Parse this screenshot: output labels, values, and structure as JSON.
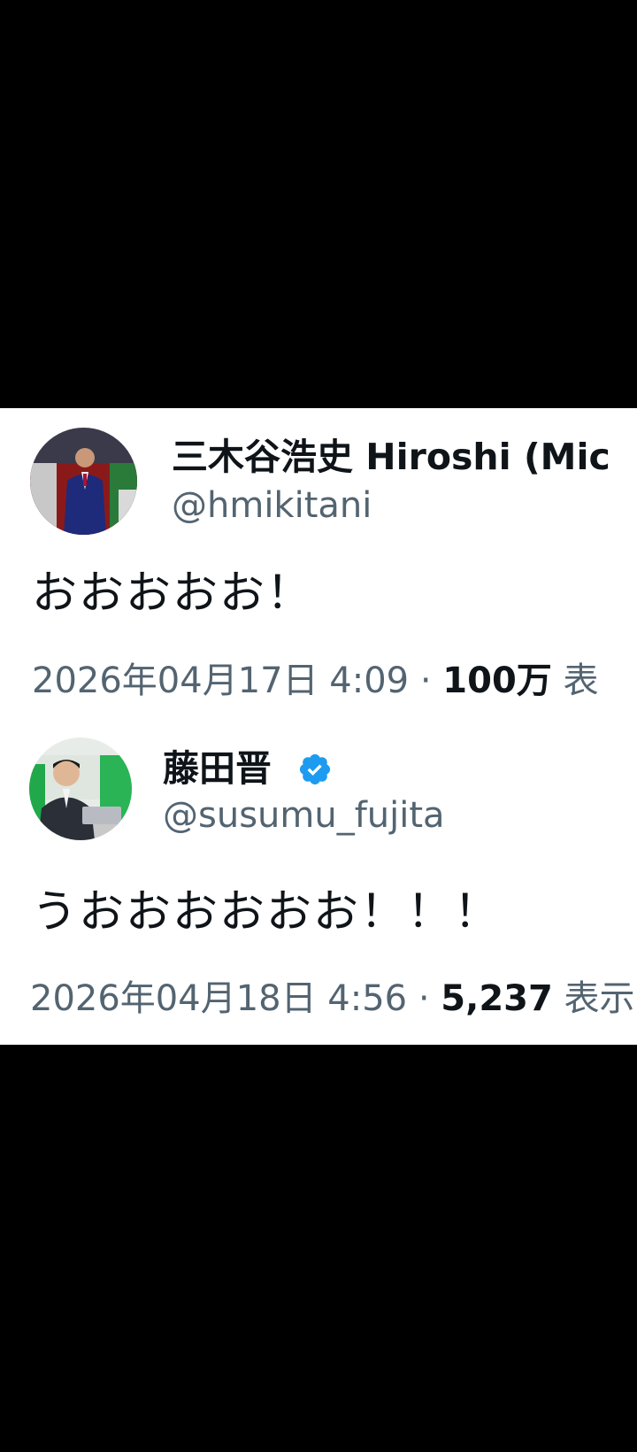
{
  "tweets": [
    {
      "display_name": "三木谷浩史 Hiroshi (Mic",
      "handle": "@hmikitani",
      "text": "おおおおお！",
      "date": "2026年04月17日 4:09",
      "separator": " · ",
      "views_count": "100万",
      "views_label": " 表",
      "verified": false,
      "avatar_icon": "avatar-photo-icon"
    },
    {
      "display_name": "藤田晋",
      "handle": "@susumu_fujita",
      "text": "うおおおおおお！！！",
      "date": "2026年04月18日 4:56",
      "separator": " · ",
      "views_count": "5,237",
      "views_label": " 表示",
      "verified": true,
      "verified_icon": "verified-badge-icon",
      "avatar_icon": "avatar-photo-icon"
    }
  ],
  "colors": {
    "background": "#000000",
    "card": "#ffffff",
    "text_primary": "#0f1419",
    "text_secondary": "#536471",
    "verified_blue": "#1d9bf0"
  }
}
